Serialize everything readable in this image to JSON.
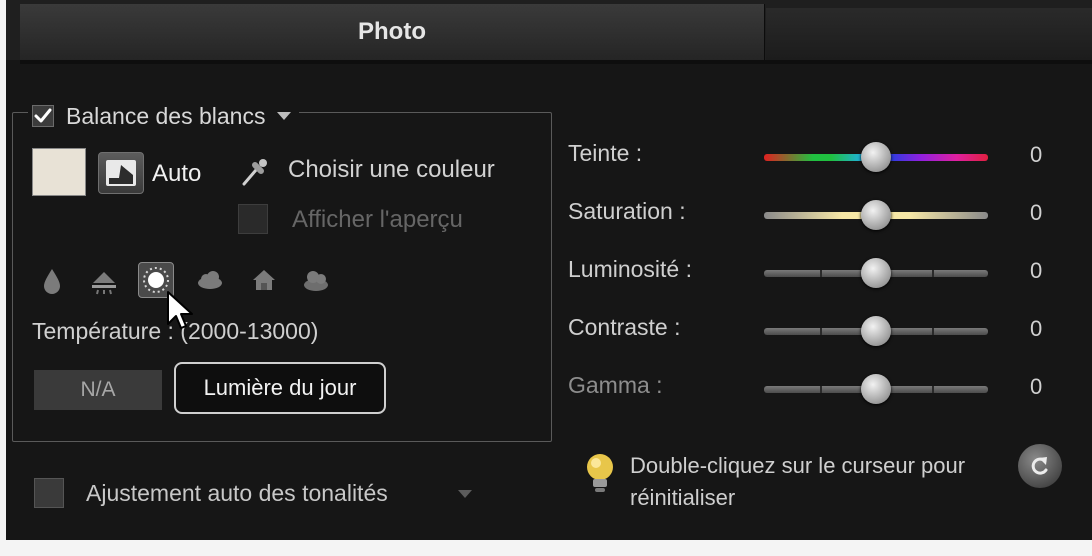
{
  "tabs": {
    "active_label": "Photo"
  },
  "white_balance": {
    "checked": true,
    "label": "Balance des blancs",
    "swatch_color": "#e8e2d6",
    "auto_label": "Auto",
    "pick_color_label": "Choisir une couleur",
    "show_preview_label": "Afficher l'aperçu",
    "presets": [
      {
        "icon": "candle-icon"
      },
      {
        "icon": "fluorescent-lamp-icon"
      },
      {
        "icon": "sun-icon",
        "selected": true
      },
      {
        "icon": "cloud-icon"
      },
      {
        "icon": "shade-house-icon"
      },
      {
        "icon": "overcast-icon"
      }
    ],
    "temperature_label": "Température : (2000-13000)",
    "temperature_value": "N/A",
    "tooltip": "Lumière du jour"
  },
  "auto_tone": {
    "label": "Ajustement auto des tonalités",
    "checked": false
  },
  "sliders": [
    {
      "id": "teinte",
      "label": "Teinte :",
      "value": "0",
      "position": 0.5,
      "track": "rainbow"
    },
    {
      "id": "saturation",
      "label": "Saturation :",
      "value": "0",
      "position": 0.5,
      "track": "saturation"
    },
    {
      "id": "luminosite",
      "label": "Luminosité :",
      "value": "0",
      "position": 0.5,
      "track": "gray"
    },
    {
      "id": "contraste",
      "label": "Contraste :",
      "value": "0",
      "position": 0.5,
      "track": "gray"
    },
    {
      "id": "gamma",
      "label": "Gamma :",
      "value": "0",
      "position": 0.5,
      "track": "gray",
      "dimmed": true
    }
  ],
  "hint": {
    "icon": "lightbulb-icon",
    "text": "Double-cliquez sur le curseur pour réinitialiser"
  },
  "reset_button": {
    "icon": "reset-icon"
  }
}
